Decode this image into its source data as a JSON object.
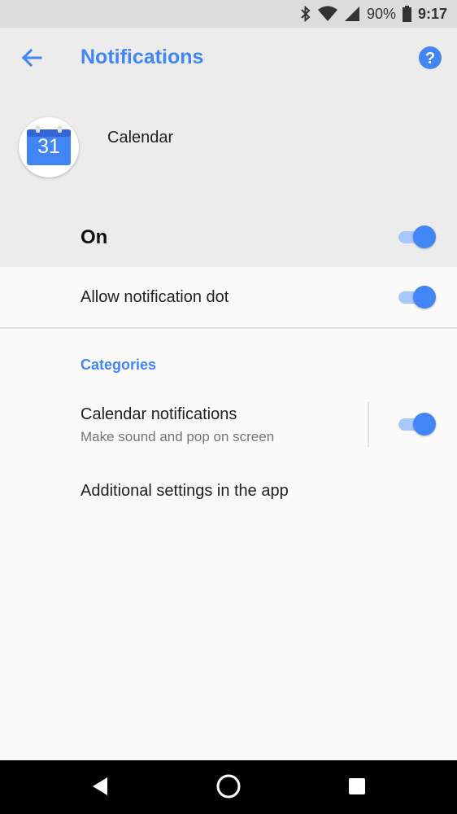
{
  "status_bar": {
    "battery_percent": "90%",
    "time": "9:17",
    "icons": [
      "bluetooth-icon",
      "wifi-icon",
      "signal-icon",
      "battery-icon"
    ]
  },
  "toolbar": {
    "title": "Notifications",
    "back_icon": "arrow-back-icon",
    "help_icon": "help-icon"
  },
  "app": {
    "name": "Calendar",
    "icon_number": "31"
  },
  "master_toggle": {
    "label": "On",
    "checked": true
  },
  "settings": {
    "notification_dot": {
      "label": "Allow notification dot",
      "checked": true
    },
    "categories_header": "Categories",
    "calendar_notifications": {
      "title": "Calendar notifications",
      "subtitle": "Make sound and pop on screen",
      "checked": true
    },
    "additional_settings": {
      "label": "Additional settings in the app"
    }
  },
  "nav_bar": {
    "icons": [
      "nav-back-icon",
      "nav-home-icon",
      "nav-recents-icon"
    ]
  },
  "colors": {
    "accent": "#4285f4",
    "header_bg": "#ececec",
    "body_bg": "#fafafa",
    "status_bar_bg": "#dcdcdc",
    "nav_bar_bg": "#000000"
  }
}
